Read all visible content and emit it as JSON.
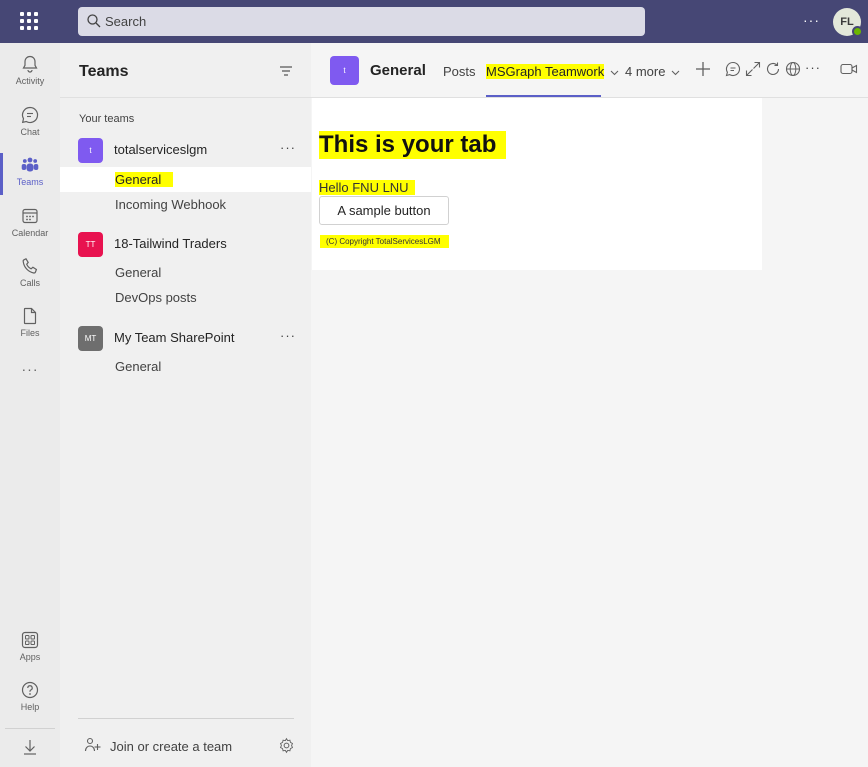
{
  "topbar": {
    "search_placeholder": "Search",
    "avatar_initials": "FL",
    "more_label": "···"
  },
  "rail": {
    "items": [
      {
        "label": "Activity",
        "icon": "bell-icon"
      },
      {
        "label": "Chat",
        "icon": "chat-icon"
      },
      {
        "label": "Teams",
        "icon": "teams-icon",
        "active": true
      },
      {
        "label": "Calendar",
        "icon": "calendar-icon"
      },
      {
        "label": "Calls",
        "icon": "phone-icon"
      },
      {
        "label": "Files",
        "icon": "file-icon"
      }
    ],
    "more_label": "···",
    "bottom_items": [
      {
        "label": "Apps",
        "icon": "apps-icon"
      },
      {
        "label": "Help",
        "icon": "help-icon"
      }
    ]
  },
  "panel": {
    "title": "Teams",
    "section_label": "Your teams",
    "teams": [
      {
        "name": "totalserviceslgm",
        "tile_text": "t",
        "tile_color": "#7f5af0",
        "channels": [
          "General",
          "Incoming Webhook"
        ]
      },
      {
        "name": "18-Tailwind Traders",
        "tile_text": "TT",
        "tile_color": "#e8124f",
        "channels": [
          "General",
          "DevOps posts"
        ]
      },
      {
        "name": "My Team SharePoint",
        "tile_text": "MT",
        "tile_color": "#6e6e6e",
        "channels": [
          "General"
        ]
      }
    ],
    "join_label": "Join or create a team"
  },
  "channel_header": {
    "tile_text": "t",
    "name": "General",
    "tabs": {
      "posts": "Posts",
      "active": "MSGraph Teamwork",
      "more": "4 more"
    }
  },
  "tab_content": {
    "heading": "This is your tab",
    "greeting": "Hello FNU LNU",
    "button_label": "A sample button",
    "copyright": "(C) Copyright TotalServicesLGM"
  },
  "colors": {
    "topbar": "#464775",
    "accent": "#5b5fc7",
    "highlight": "#ffff00"
  }
}
